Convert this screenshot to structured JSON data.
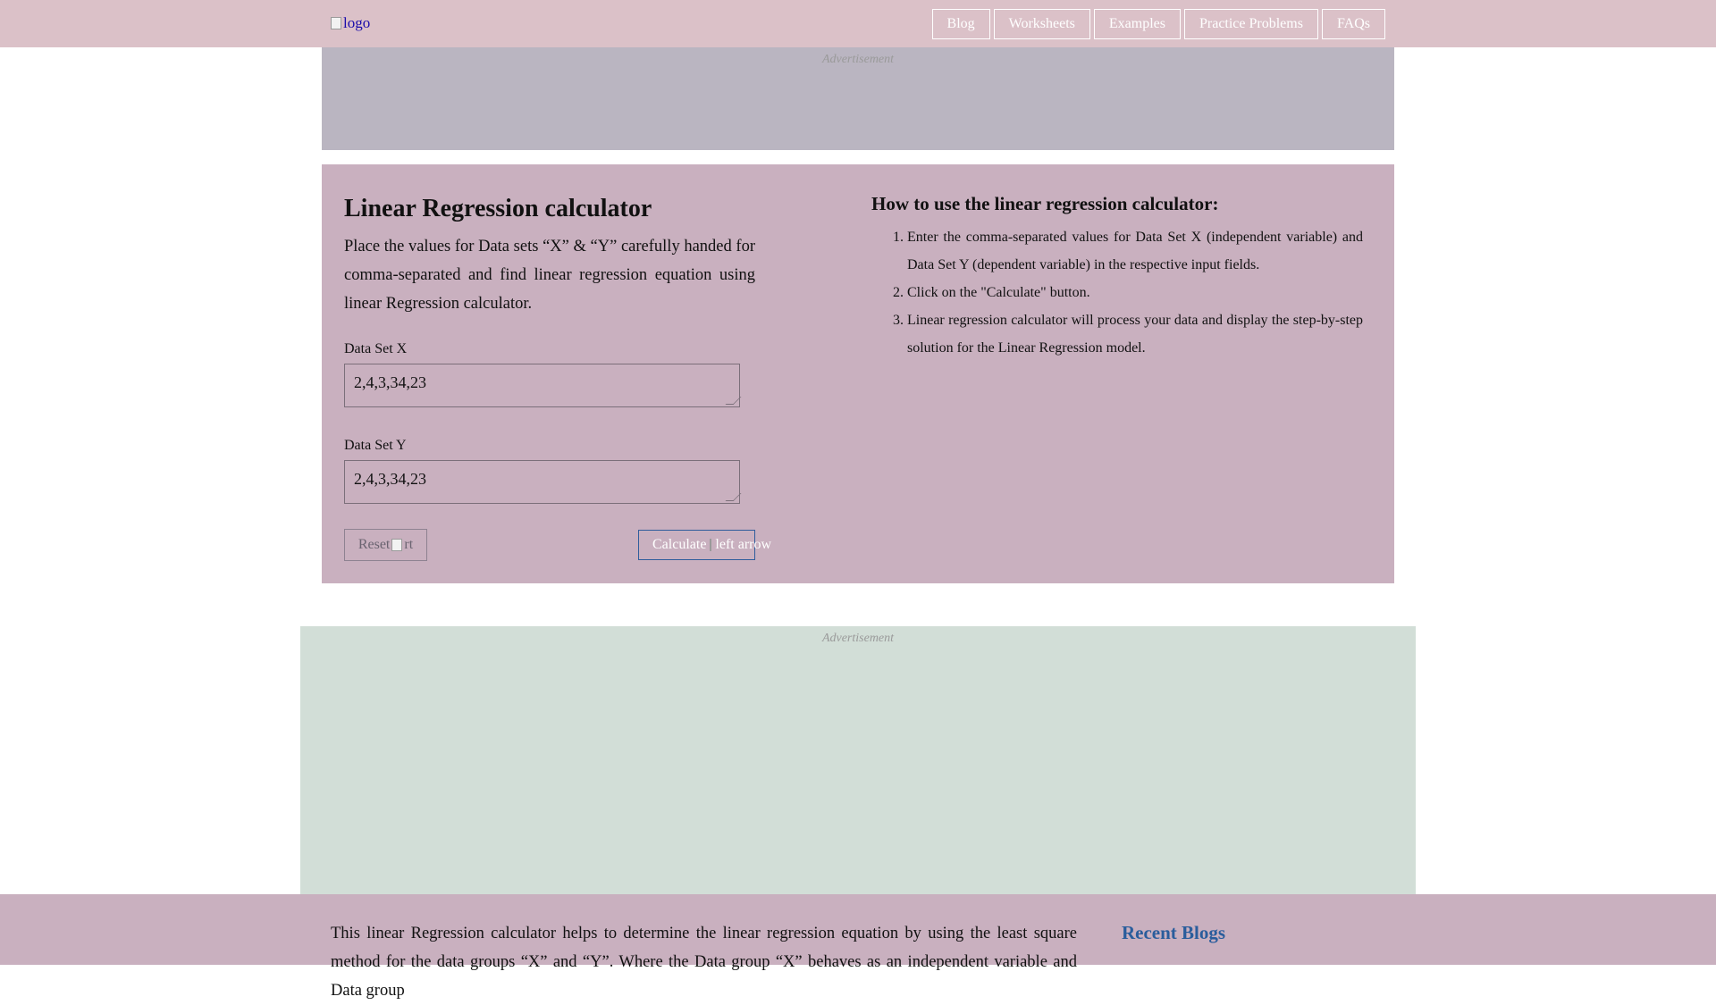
{
  "header": {
    "logo_alt": "logo",
    "nav": [
      "Blog",
      "Worksheets",
      "Examples",
      "Practice Problems",
      "FAQs"
    ]
  },
  "ads": {
    "top_label": "Advertisement",
    "bottom_label": "Advertisement"
  },
  "calculator": {
    "title": "Linear Regression calculator",
    "description": "Place the values for Data sets “X” & “Y” carefully handed for comma-separated and find linear regression equation using linear Regression calculator.",
    "field_x_label": "Data Set X",
    "field_x_value": "2,4,3,34,23",
    "field_y_label": "Data Set Y",
    "field_y_value": "2,4,3,34,23",
    "reset_label": "Reset",
    "reset_icon_alt": "rt",
    "calculate_label": "Calculate",
    "calculate_icon_alt": "left arrow"
  },
  "howto": {
    "title": "How to use the linear regression calculator:",
    "steps": [
      "Enter the comma-separated values for Data Set X (independent variable) and Data Set Y (dependent variable) in the respective input fields.",
      "Click on the \"Calculate\" button.",
      "Linear regression calculator will process your data and display the step-by-step solution for the Linear Regression model."
    ]
  },
  "bottom": {
    "text": "This linear Regression calculator helps to determine the linear regression equation by using the least square method for the data groups “X” and “Y”. Where the Data group “X” behaves as an independent variable and Data group",
    "recent_blogs_title": "Recent Blogs"
  }
}
